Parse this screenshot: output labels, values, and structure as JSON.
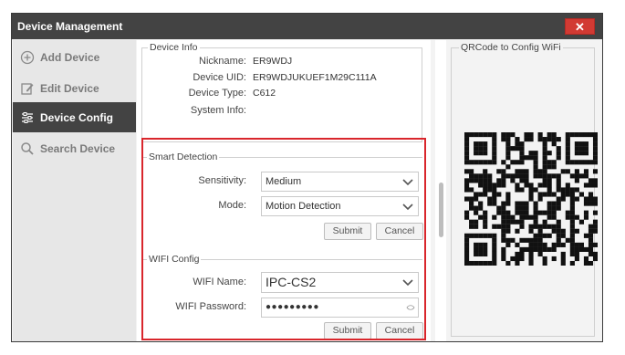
{
  "window": {
    "title": "Device Management",
    "close_label": "✕"
  },
  "sidebar": {
    "items": [
      {
        "label": "Add Device",
        "icon": "plus-circle-icon"
      },
      {
        "label": "Edit Device",
        "icon": "edit-icon"
      },
      {
        "label": "Device Config",
        "icon": "sliders-icon",
        "active": true
      },
      {
        "label": "Search Device",
        "icon": "search-icon"
      }
    ]
  },
  "device_info": {
    "legend": "Device Info",
    "fields": [
      {
        "label": "Nickname:",
        "value": "ER9WDJ"
      },
      {
        "label": "Device UID:",
        "value": "ER9WDJUKUEF1M29C111A"
      },
      {
        "label": "Device Type:",
        "value": "C612"
      },
      {
        "label": "System Info:",
        "value": ""
      }
    ]
  },
  "smart_detection": {
    "legend": "Smart Detection",
    "sensitivity_label": "Sensitivity:",
    "sensitivity_value": "Medium",
    "mode_label": "Mode:",
    "mode_value": "Motion Detection",
    "submit_label": "Submit",
    "cancel_label": "Cancel"
  },
  "wifi_config": {
    "legend": "WIFI Config",
    "name_label": "WIFI Name:",
    "name_value": "IPC-CS2",
    "password_label": "WIFI Password:",
    "password_value": "●●●●●●●●●",
    "submit_label": "Submit",
    "cancel_label": "Cancel"
  },
  "qr": {
    "legend": "QRCode to Config WiFi"
  },
  "colors": {
    "titlebar": "#434343",
    "close": "#d23a33",
    "highlight": "#d9262c",
    "active_nav": "#434343"
  }
}
